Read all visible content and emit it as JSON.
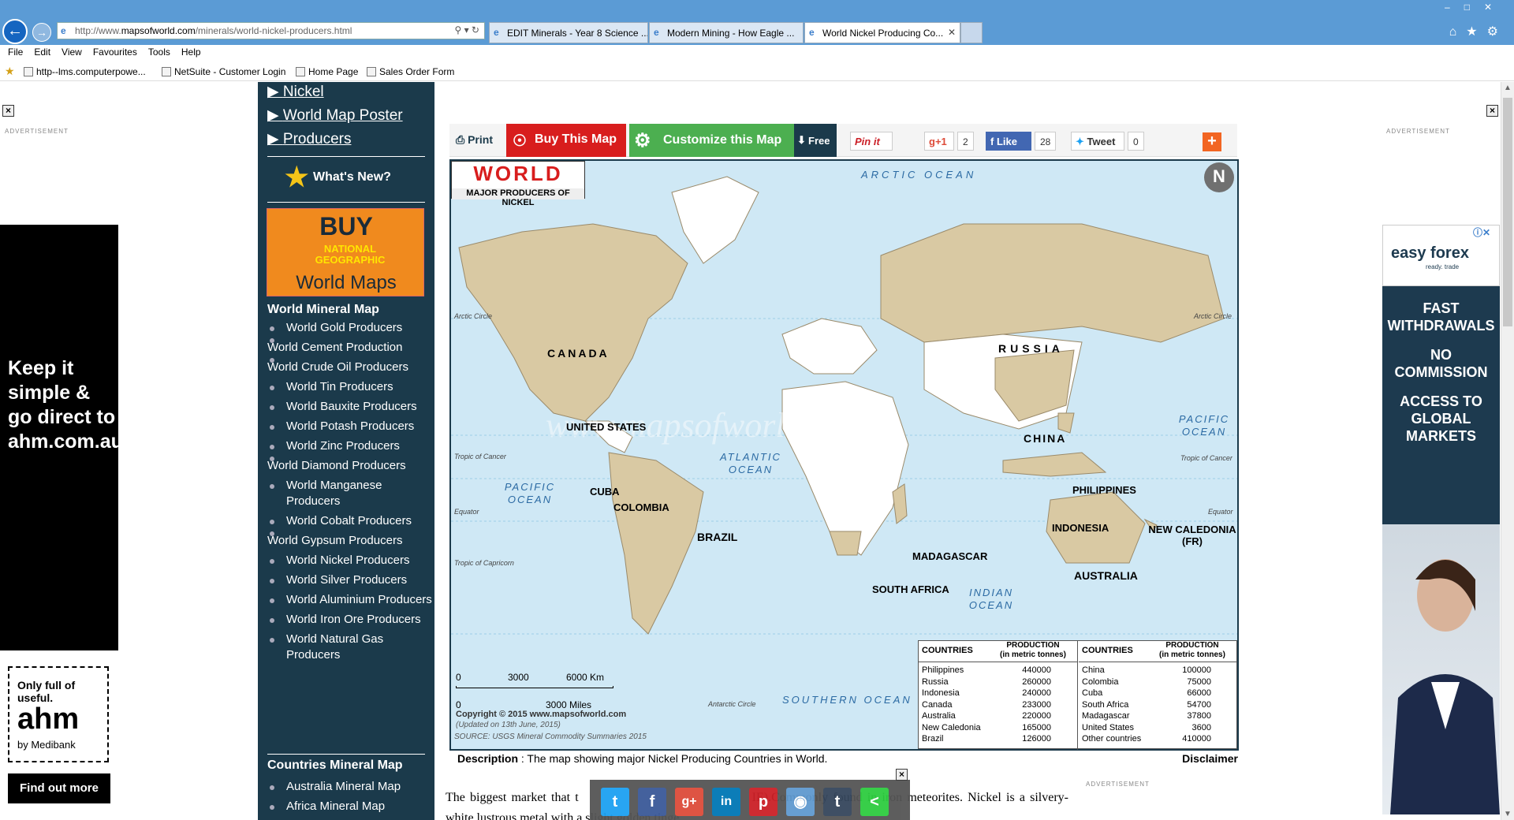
{
  "browser": {
    "url_prefix": "http://www.",
    "url_domain": "mapsofworld.com",
    "url_path": "/minerals/world-nickel-producers.html",
    "tabs": [
      {
        "label": "EDIT Minerals - Year 8 Science ..."
      },
      {
        "label": "Modern Mining - How Eagle ..."
      },
      {
        "label": "World Nickel Producing Co..."
      }
    ],
    "menu": [
      "File",
      "Edit",
      "View",
      "Favourites",
      "Tools",
      "Help"
    ],
    "favorites": [
      "http--lms.computerpowe...",
      "NetSuite - Customer Login",
      "Home Page",
      "Sales Order Form"
    ]
  },
  "left_ad": {
    "label": "ADVERTISEMENT",
    "headline": "Keep it simple & go direct to ahm.com.au",
    "tagline": "Only full of useful.",
    "brand": "ahm",
    "by": "by Medibank",
    "cta": "Find out more"
  },
  "sidebar": {
    "top_links": [
      "Nickel",
      "World Map Poster",
      "Producers"
    ],
    "whats_new": "What's New?",
    "buy": {
      "line1": "BUY",
      "line2": "NATIONAL GEOGRAPHIC",
      "line3": "World Maps"
    },
    "mineral_heading": "World Mineral Map",
    "mineral_links": [
      "World Gold Producers",
      "World Cement Production",
      "World Crude Oil Producers",
      "World Tin Producers",
      "World Bauxite Producers",
      "World Potash Producers",
      "World Zinc Producers",
      "World Diamond Producers",
      "World Manganese Producers",
      "World Cobalt Producers",
      "World Gypsum Producers",
      "World Nickel Producers",
      "World Silver Producers",
      "World Aluminium Producers",
      "World Iron Ore Producers",
      "World Natural Gas Producers"
    ],
    "countries_heading": "Countries Mineral Map",
    "country_links": [
      "Australia Mineral Map",
      "Africa Mineral Map"
    ]
  },
  "toolbar": {
    "print": "Print",
    "buy": "Buy This Map",
    "customize": "Customize this Map",
    "free": "Free",
    "pin": "Pin it",
    "gplus": "g+1",
    "gplus_count": "2",
    "like": "Like",
    "like_count": "28",
    "tweet": "Tweet",
    "tweet_count": "0",
    "more": "+"
  },
  "map": {
    "title": "WORLD",
    "subtitle": "MAJOR PRODUCERS OF NICKEL",
    "oceans": [
      "ARCTIC OCEAN",
      "ATLANTIC OCEAN",
      "PACIFIC OCEAN",
      "PACIFIC OCEAN",
      "INDIAN OCEAN",
      "SOUTHERN OCEAN"
    ],
    "lines": [
      "Arctic Circle",
      "Arctic Circle",
      "Tropic of Cancer",
      "Tropic of Cancer",
      "Equator",
      "Equator",
      "Tropic of Capricorn",
      "Antarctic Circle"
    ],
    "labels": [
      "CANADA",
      "UNITED STATES",
      "CUBA",
      "COLOMBIA",
      "BRAZIL",
      "RUSSIA",
      "CHINA",
      "PHILIPPINES",
      "INDONESIA",
      "NEW CALEDONIA (FR)",
      "AUSTRALIA",
      "MADAGASCAR",
      "SOUTH AFRICA"
    ],
    "watermark": "www.mapsofworld.com",
    "scale_km": [
      "0",
      "3000",
      "6000 Km"
    ],
    "scale_mi": [
      "0",
      "3000 Miles"
    ],
    "copyright": "Copyright © 2015 www.mapsofworld.com",
    "updated": "(Updated on 13th June, 2015)",
    "source": "SOURCE: USGS Mineral Commodity Summaries 2015",
    "table_headers": {
      "countries": "COUNTRIES",
      "production": "PRODUCTION",
      "units": "(in metric tonnes)"
    },
    "table_left": [
      {
        "country": "Philippines",
        "value": "440000"
      },
      {
        "country": "Russia",
        "value": "260000"
      },
      {
        "country": "Indonesia",
        "value": "240000"
      },
      {
        "country": "Canada",
        "value": "233000"
      },
      {
        "country": "Australia",
        "value": "220000"
      },
      {
        "country": "New Caledonia",
        "value": "165000"
      },
      {
        "country": "Brazil",
        "value": "126000"
      }
    ],
    "table_right": [
      {
        "country": "China",
        "value": "100000"
      },
      {
        "country": "Colombia",
        "value": "75000"
      },
      {
        "country": "Cuba",
        "value": "66000"
      },
      {
        "country": "South Africa",
        "value": "54700"
      },
      {
        "country": "Madagascar",
        "value": "37800"
      },
      {
        "country": "United States",
        "value": "3600"
      },
      {
        "country": "Other countries",
        "value": "410000"
      }
    ]
  },
  "description": {
    "label": "Description",
    "text": " : The map showing major Nickel Producing Countries in World.",
    "disclaimer": "Disclaimer"
  },
  "article": {
    "text_start": "The biggest market that t",
    "text_end": "IE).Commonly found in iron meteorites. Nickel is a silvery-white lustrous metal with a slight golden tinge."
  },
  "right_ad": {
    "label": "ADVERTISEMENT",
    "brand": "easy forex",
    "tag": "ready. trade",
    "lines": [
      "FAST WITHDRAWALS",
      "NO COMMISSION",
      "ACCESS TO GLOBAL MARKETS"
    ]
  },
  "bottom_ad_label": "ADVERTISEMENT",
  "colors": {
    "sidebar": "#1b3a4b",
    "ocean": "#cfe8f5",
    "producer": "#d9c9a3",
    "land": "#ffffff",
    "buy": "#d81d1d",
    "customize": "#4caf50"
  }
}
